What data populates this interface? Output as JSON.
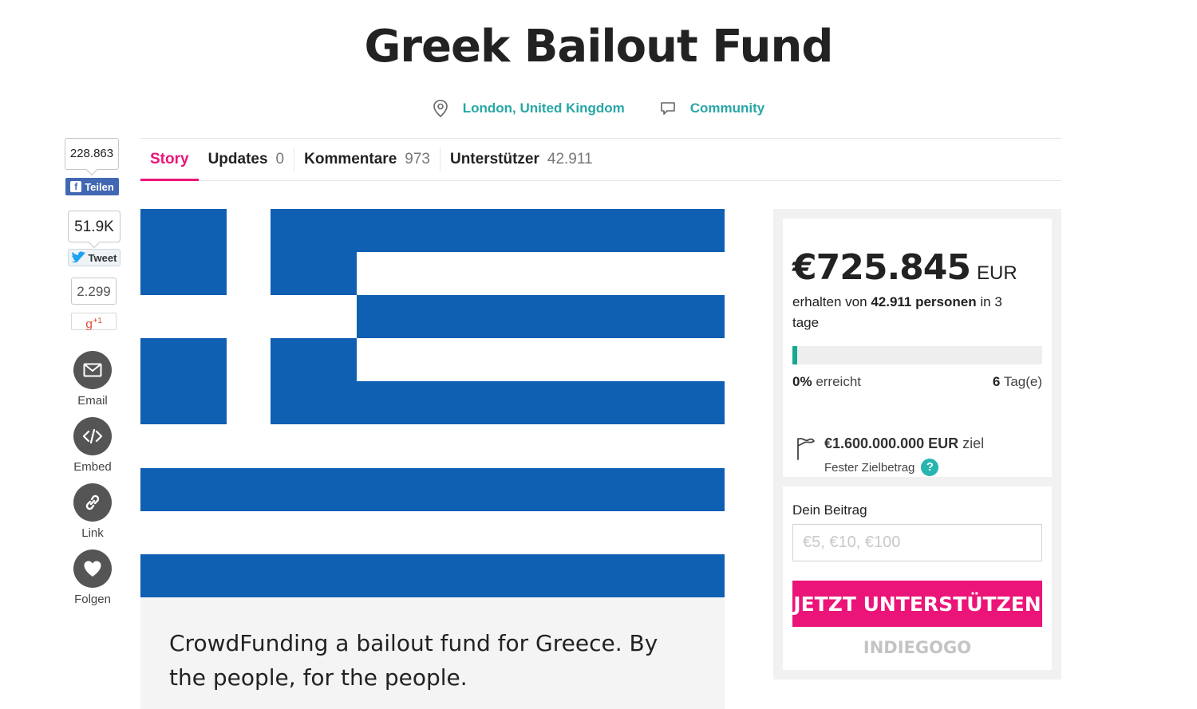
{
  "title": "Greek Bailout Fund",
  "meta": {
    "location": "London, United Kingdom",
    "category": "Community"
  },
  "tabs": [
    {
      "label": "Story",
      "count": ""
    },
    {
      "label": "Updates",
      "count": "0"
    },
    {
      "label": "Kommentare",
      "count": "973"
    },
    {
      "label": "Unterstützer",
      "count": "42.911"
    }
  ],
  "social": {
    "facebook_count": "228.863",
    "facebook_label": "Teilen",
    "twitter_count": "51.9K",
    "twitter_label": "Tweet",
    "gplus_count": "2.299",
    "gplus_label": "+1",
    "email_label": "Email",
    "embed_label": "Embed",
    "link_label": "Link",
    "follow_label": "Folgen"
  },
  "story": {
    "text": "CrowdFunding a bailout fund for Greece. By the people, for the people."
  },
  "funding": {
    "amount": "€725.845",
    "currency": "EUR",
    "received_prefix": "erhalten von",
    "backers": "42.911 personen",
    "received_suffix": "in 3 tage",
    "progress_fraction": 0.004,
    "percent": "0%",
    "percent_label": "erreicht",
    "days": "6",
    "days_label": "Tag(e)",
    "goal_amount": "€1.600.000.000",
    "goal_currency": "EUR",
    "goal_label": "ziel",
    "goal_type": "Fester Zielbetrag",
    "help": "?"
  },
  "contribute": {
    "label": "Dein Beitrag",
    "placeholder": "€5, €10, €100",
    "button": "JETZT UNTERSTÜTZEN",
    "brand": "INDIEGOGO"
  },
  "colors": {
    "accent": "#eb1478",
    "teal": "#27a7a6",
    "flag_blue": "#0f5fb3",
    "progress": "#18a892"
  }
}
